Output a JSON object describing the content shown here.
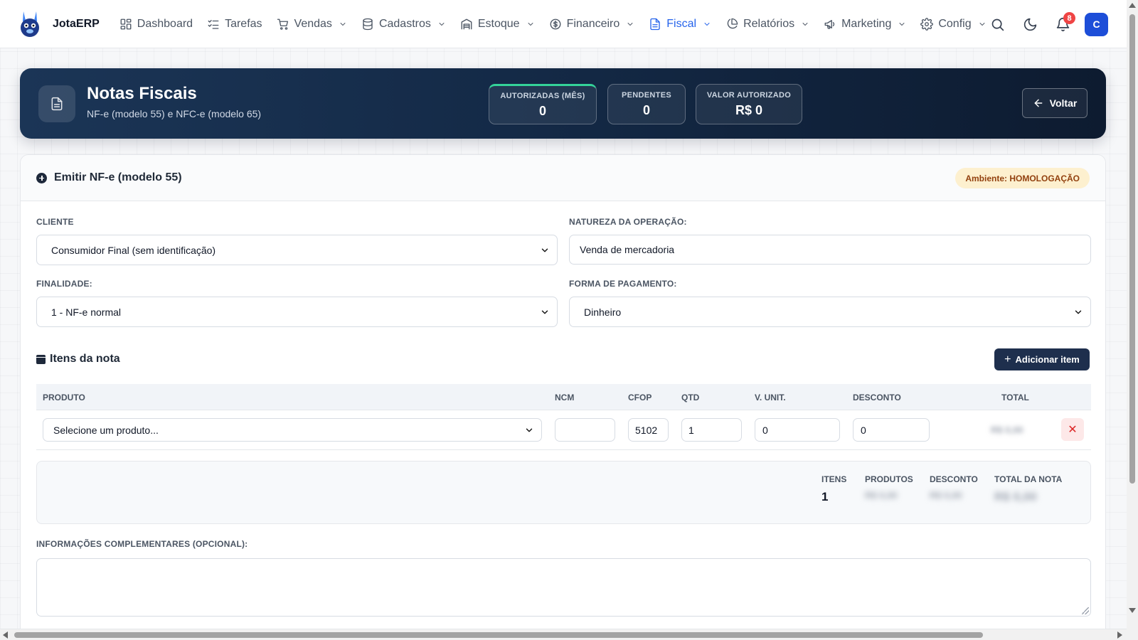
{
  "app": {
    "name": "JotaERP"
  },
  "nav": {
    "items": [
      {
        "label": "Dashboard",
        "icon": "dashboard-icon",
        "dropdown": false,
        "active": false
      },
      {
        "label": "Tarefas",
        "icon": "tasks-icon",
        "dropdown": false,
        "active": false
      },
      {
        "label": "Vendas",
        "icon": "cart-icon",
        "dropdown": true,
        "active": false
      },
      {
        "label": "Cadastros",
        "icon": "database-icon",
        "dropdown": true,
        "active": false
      },
      {
        "label": "Estoque",
        "icon": "warehouse-icon",
        "dropdown": true,
        "active": false
      },
      {
        "label": "Financeiro",
        "icon": "dollar-icon",
        "dropdown": true,
        "active": false
      },
      {
        "label": "Fiscal",
        "icon": "document-icon",
        "dropdown": true,
        "active": true
      },
      {
        "label": "Relatórios",
        "icon": "pie-chart-icon",
        "dropdown": true,
        "active": false
      },
      {
        "label": "Marketing",
        "icon": "megaphone-icon",
        "dropdown": true,
        "active": false
      },
      {
        "label": "Config",
        "icon": "gear-icon",
        "dropdown": true,
        "active": false
      }
    ],
    "notifications_count": "8",
    "avatar_initial": "C",
    "active_color": "#2563eb"
  },
  "hero": {
    "title": "Notas Fiscais",
    "subtitle": "NF-e (modelo 55) e NFC-e (modelo 65)",
    "stats": [
      {
        "label": "AUTORIZADAS (MÊS)",
        "value": "0"
      },
      {
        "label": "PENDENTES",
        "value": "0"
      },
      {
        "label": "VALOR AUTORIZADO",
        "value": "R$ 0"
      }
    ],
    "back_label": "Voltar"
  },
  "form": {
    "title": "Emitir NF-e (modelo 55)",
    "environment_badge": "Ambiente: HOMOLOGAÇÃO",
    "cliente_label": "CLIENTE",
    "cliente_value": "Consumidor Final (sem identificação)",
    "natureza_label": "NATUREZA DA OPERAÇÃO:",
    "natureza_value": "Venda de mercadoria",
    "finalidade_label": "FINALIDADE:",
    "finalidade_value": "1 - NF-e normal",
    "pagamento_label": "FORMA DE PAGAMENTO:",
    "pagamento_value": "Dinheiro",
    "items_title": "Itens da nota",
    "add_item_label": "Adicionar item",
    "columns": [
      "PRODUTO",
      "NCM",
      "CFOP",
      "QTD",
      "V. UNIT.",
      "DESCONTO",
      "TOTAL"
    ],
    "row": {
      "produto": "Selecione um produto...",
      "ncm": "",
      "cfop": "5102",
      "qtd": "1",
      "v_unit": "0",
      "desconto": "0",
      "total": "R$ 0,00"
    },
    "totals": {
      "itens_label": "ITENS",
      "itens_value": "1",
      "produtos_label": "PRODUTOS",
      "produtos_value": "R$ 0,00",
      "desconto_label": "DESCONTO",
      "desconto_value": "R$ 0,00",
      "total_label": "TOTAL DA NOTA",
      "total_value": "R$ 0,00"
    },
    "info_label": "INFORMAÇÕES COMPLEMENTARES (OPCIONAL):",
    "info_value": ""
  }
}
